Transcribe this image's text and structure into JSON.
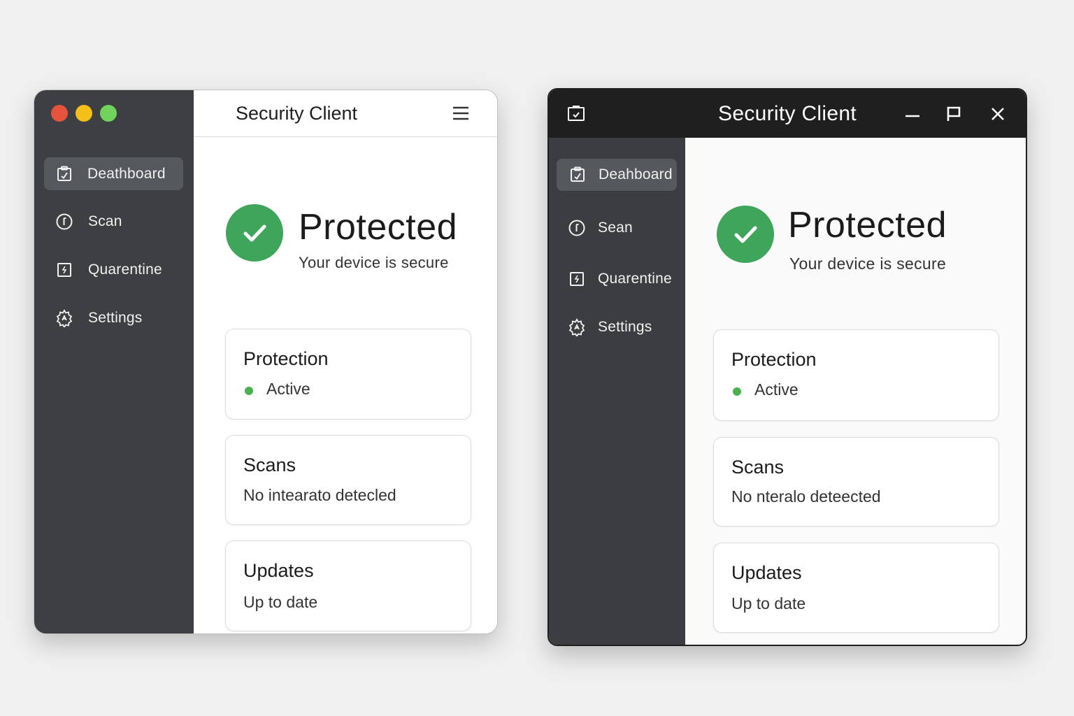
{
  "mac_window": {
    "title": "Security Client",
    "sidebar": {
      "items": [
        {
          "label": "Deathboard",
          "icon": "dashboard-icon",
          "active": true
        },
        {
          "label": "Scan",
          "icon": "scan-icon"
        },
        {
          "label": "Quarentine",
          "icon": "quarantine-icon"
        },
        {
          "label": "Settings",
          "icon": "settings-gear-icon"
        }
      ]
    },
    "hero": {
      "title": "Protected",
      "subtitle": "Your device is secure"
    },
    "cards": {
      "protection": {
        "title": "Protection",
        "status": "Active"
      },
      "scans": {
        "title": "Scans",
        "text": "No intearato detecled"
      },
      "updates": {
        "title": "Updates",
        "text": "Up to date"
      }
    }
  },
  "win_window": {
    "title": "Security Client",
    "sidebar": {
      "items": [
        {
          "label": "Deahboard",
          "icon": "dashboard-icon",
          "active": true
        },
        {
          "label": "Sean",
          "icon": "scan-icon"
        },
        {
          "label": "Quarentine",
          "icon": "quarantine-icon"
        },
        {
          "label": "Settings",
          "icon": "settings-gear-icon"
        }
      ]
    },
    "hero": {
      "title": "Protected",
      "subtitle": "Your device is secure"
    },
    "cards": {
      "protection": {
        "title": "Protection",
        "status": "Active"
      },
      "scans": {
        "title": "Scans",
        "text": "No nteralo deteected"
      },
      "updates": {
        "title": "Updates",
        "text": "Up to date"
      }
    }
  },
  "colors": {
    "sidebar": "#3d3f43",
    "success_green": "#3fa55a",
    "status_dot": "#4caf50",
    "traffic_red": "#e5533d",
    "traffic_yellow": "#f3c019",
    "traffic_green": "#71d35c",
    "win_titlebar": "#1f1f1f"
  }
}
